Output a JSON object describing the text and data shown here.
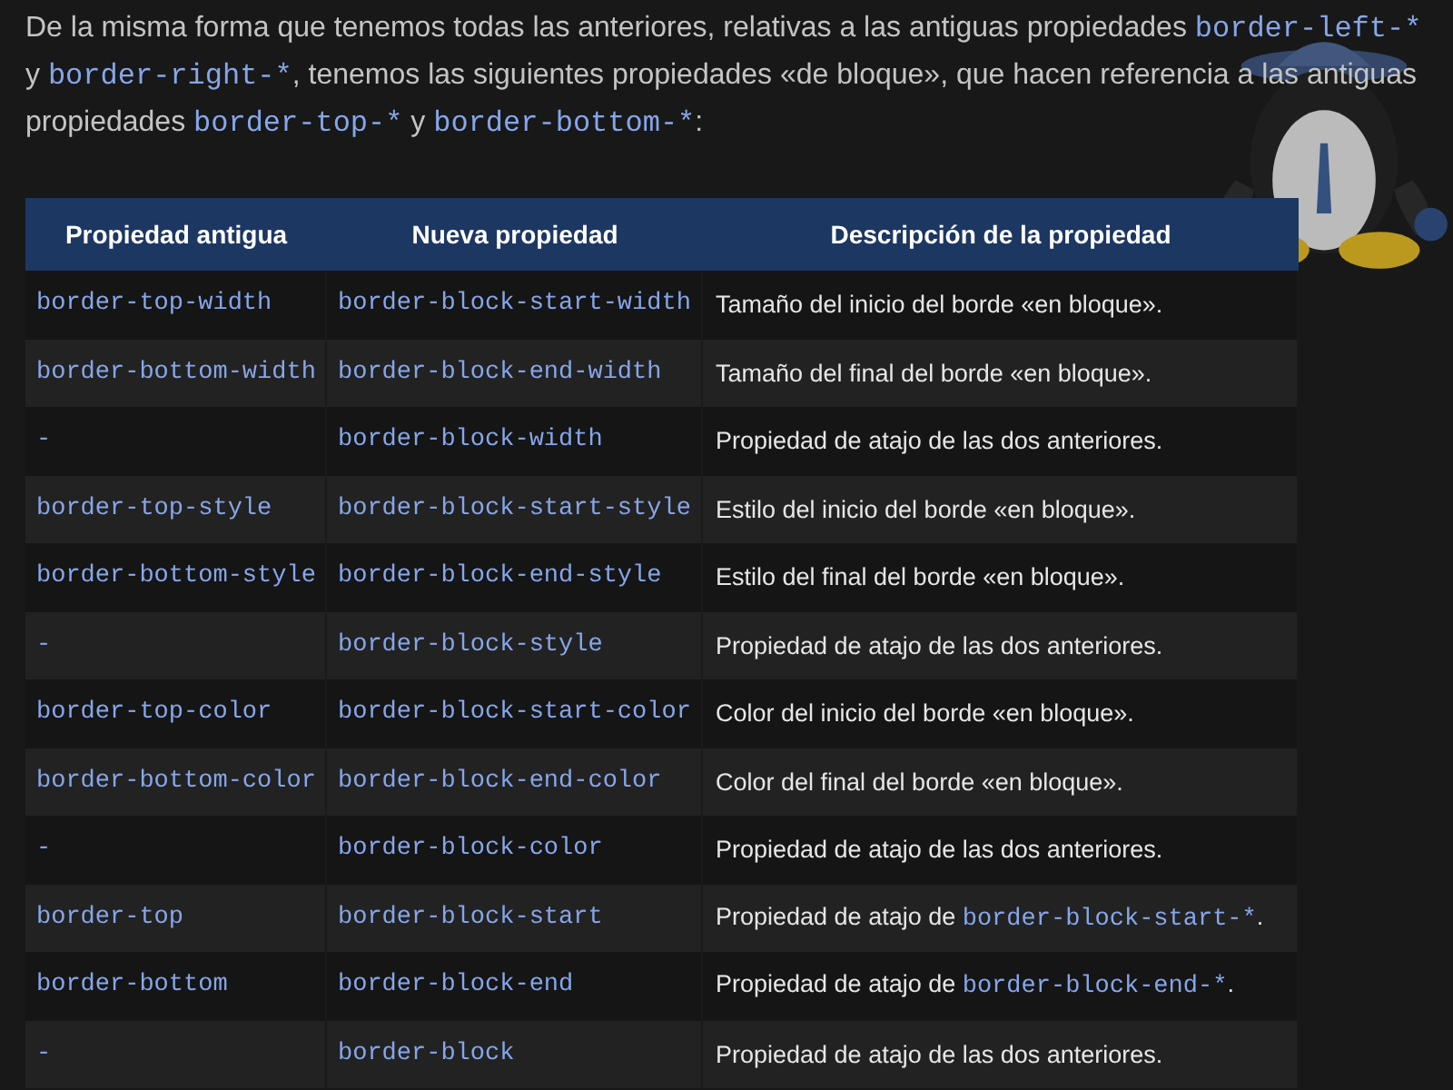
{
  "intro": [
    {
      "kind": "text",
      "text": "De la misma forma que tenemos todas las anteriores, relativas a las antiguas propiedades "
    },
    {
      "kind": "code",
      "text": "border-left-*"
    },
    {
      "kind": "text",
      "text": " y "
    },
    {
      "kind": "code",
      "text": "border-right-*"
    },
    {
      "kind": "text",
      "text": ", tenemos las siguientes propiedades «de bloque», que hacen referencia a las antiguas propiedades "
    },
    {
      "kind": "code",
      "text": "border-top-*"
    },
    {
      "kind": "text",
      "text": " y "
    },
    {
      "kind": "code",
      "text": "border-bottom-*"
    },
    {
      "kind": "text",
      "text": ":"
    }
  ],
  "table": {
    "columns": [
      "Propiedad antigua",
      "Nueva propiedad",
      "Descripción de la propiedad"
    ],
    "rows": [
      {
        "old": "border-top-width",
        "new": "border-block-start-width",
        "description": [
          {
            "kind": "text",
            "text": "Tamaño del inicio del borde «en bloque»."
          }
        ]
      },
      {
        "old": "border-bottom-width",
        "new": "border-block-end-width",
        "description": [
          {
            "kind": "text",
            "text": "Tamaño del final del borde «en bloque»."
          }
        ]
      },
      {
        "old": "-",
        "new": "border-block-width",
        "description": [
          {
            "kind": "text",
            "text": "Propiedad de atajo de las dos anteriores."
          }
        ]
      },
      {
        "old": "border-top-style",
        "new": "border-block-start-style",
        "description": [
          {
            "kind": "text",
            "text": "Estilo del inicio del borde «en bloque»."
          }
        ]
      },
      {
        "old": "border-bottom-style",
        "new": "border-block-end-style",
        "description": [
          {
            "kind": "text",
            "text": "Estilo del final del borde «en bloque»."
          }
        ]
      },
      {
        "old": "-",
        "new": "border-block-style",
        "description": [
          {
            "kind": "text",
            "text": "Propiedad de atajo de las dos anteriores."
          }
        ]
      },
      {
        "old": "border-top-color",
        "new": "border-block-start-color",
        "description": [
          {
            "kind": "text",
            "text": "Color del inicio del borde «en bloque»."
          }
        ]
      },
      {
        "old": "border-bottom-color",
        "new": "border-block-end-color",
        "description": [
          {
            "kind": "text",
            "text": "Color del final del borde «en bloque»."
          }
        ]
      },
      {
        "old": "-",
        "new": "border-block-color",
        "description": [
          {
            "kind": "text",
            "text": "Propiedad de atajo de las dos anteriores."
          }
        ]
      },
      {
        "old": "border-top",
        "new": "border-block-start",
        "description": [
          {
            "kind": "text",
            "text": "Propiedad de atajo de "
          },
          {
            "kind": "code",
            "text": "border-block-start-*"
          },
          {
            "kind": "text",
            "text": "."
          }
        ]
      },
      {
        "old": "border-bottom",
        "new": "border-block-end",
        "description": [
          {
            "kind": "text",
            "text": "Propiedad de atajo de "
          },
          {
            "kind": "code",
            "text": "border-block-end-*"
          },
          {
            "kind": "text",
            "text": "."
          }
        ]
      },
      {
        "old": "-",
        "new": "border-block",
        "description": [
          {
            "kind": "text",
            "text": "Propiedad de atajo de las dos anteriores."
          }
        ]
      }
    ]
  }
}
